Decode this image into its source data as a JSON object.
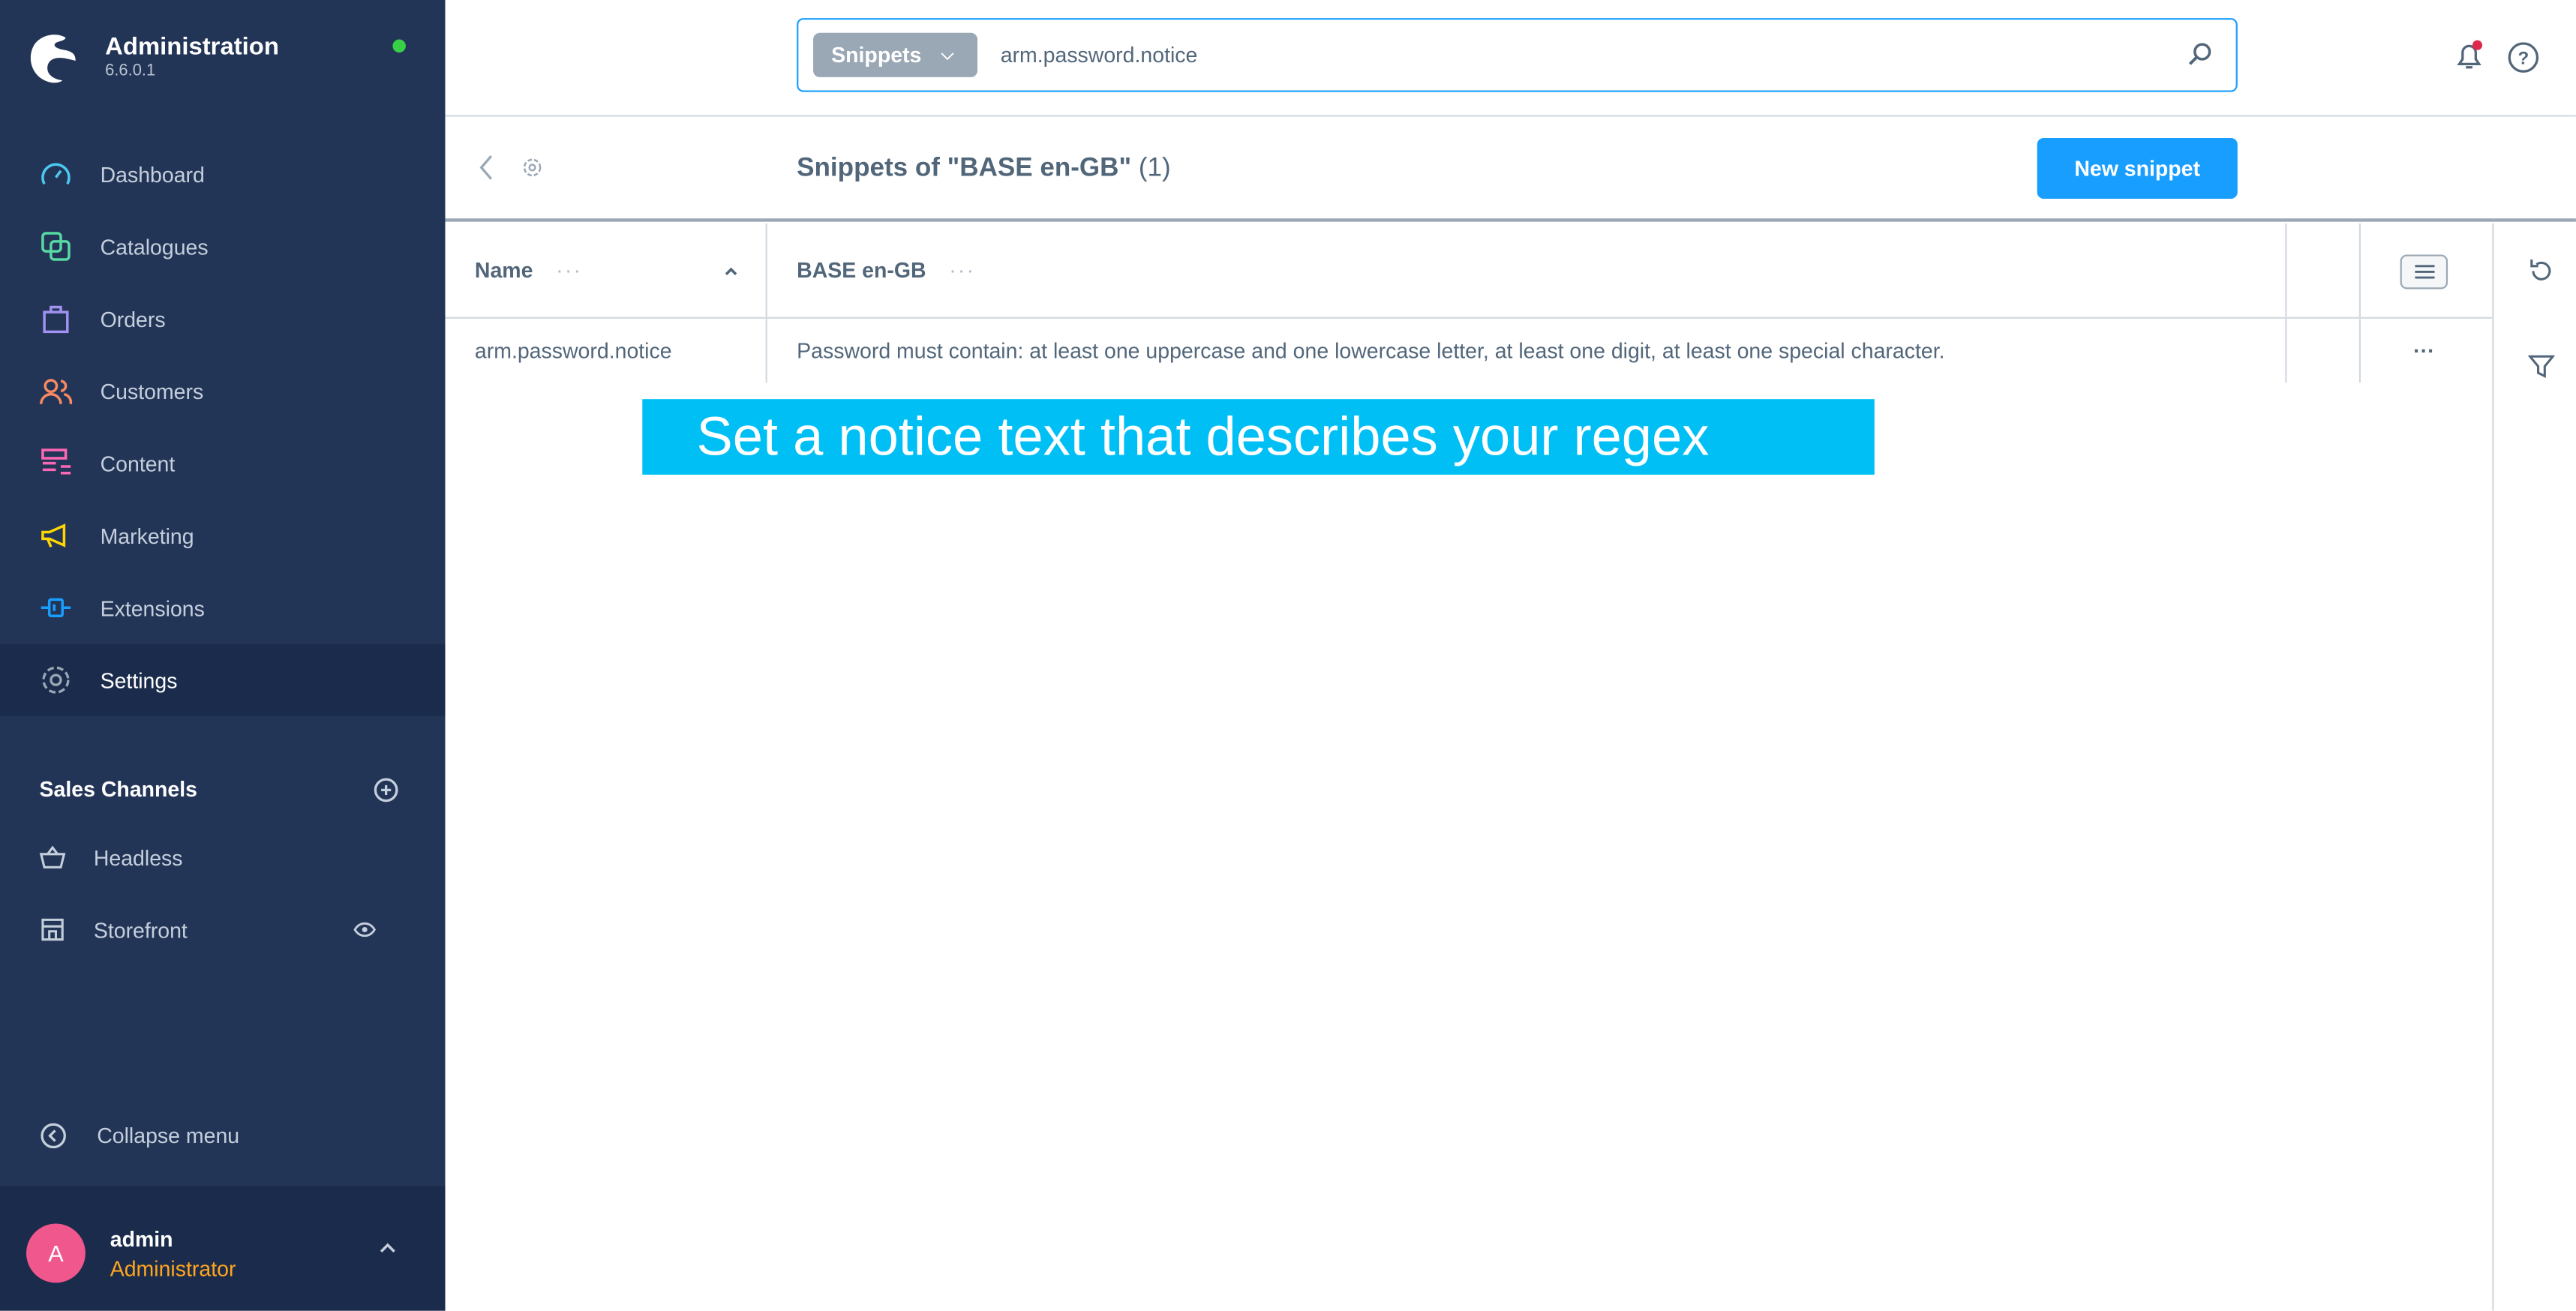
{
  "app": {
    "title": "Administration",
    "version": "6.6.0.1",
    "status_color": "#37d046"
  },
  "nav": [
    {
      "label": "Dashboard",
      "icon": "dashboard-icon",
      "color": "#4bc9f0"
    },
    {
      "label": "Catalogues",
      "icon": "catalogues-icon",
      "color": "#57d9a3"
    },
    {
      "label": "Orders",
      "icon": "orders-icon",
      "color": "#a092f0"
    },
    {
      "label": "Customers",
      "icon": "customers-icon",
      "color": "#f88962"
    },
    {
      "label": "Content",
      "icon": "content-icon",
      "color": "#ff68b4"
    },
    {
      "label": "Marketing",
      "icon": "marketing-icon",
      "color": "#ffd700"
    },
    {
      "label": "Extensions",
      "icon": "extensions-icon",
      "color": "#189eff"
    },
    {
      "label": "Settings",
      "icon": "settings-icon",
      "color": "#9aa8b5",
      "active": true
    }
  ],
  "sales_channels": {
    "title": "Sales Channels",
    "items": [
      {
        "label": "Headless"
      },
      {
        "label": "Storefront"
      }
    ]
  },
  "collapse_label": "Collapse menu",
  "user": {
    "initial": "A",
    "name": "admin",
    "role": "Administrator"
  },
  "search": {
    "type": "Snippets",
    "value": "arm.password.notice"
  },
  "page": {
    "title": "Snippets of \"BASE en-GB\"",
    "count": "(1)",
    "new_button": "New snippet"
  },
  "grid": {
    "columns": [
      "Name",
      "BASE en-GB"
    ],
    "rows": [
      {
        "name": "arm.password.notice",
        "value": "Password must contain: at least one uppercase and one lowercase letter, at least one digit, at least one special character."
      }
    ],
    "dots": "···",
    "row_actions": "···"
  },
  "banner": "Set a notice text that describes your regex"
}
